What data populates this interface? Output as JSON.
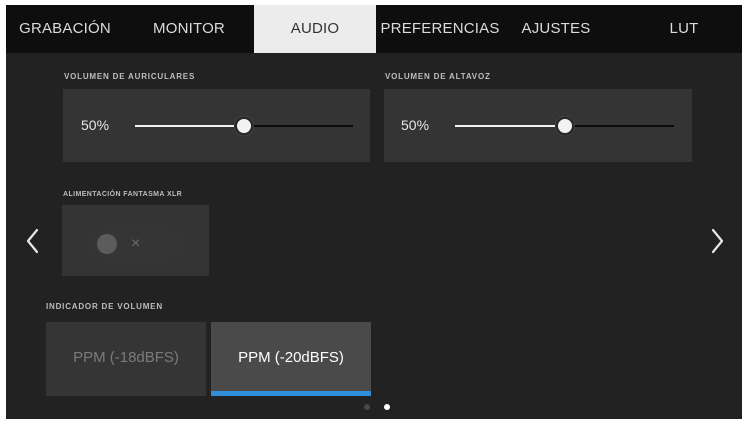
{
  "tabs": [
    {
      "label": "GRABACIÓN",
      "active": false
    },
    {
      "label": "MONITOR",
      "active": false
    },
    {
      "label": "AUDIO",
      "active": true
    },
    {
      "label": "PREFERENCIAS",
      "active": false
    },
    {
      "label": "AJUSTES",
      "active": false
    },
    {
      "label": "LUT",
      "active": false
    }
  ],
  "headphone_volume": {
    "label": "VOLUMEN DE AURICULARES",
    "value_text": "50%",
    "level": 0.5
  },
  "speaker_volume": {
    "label": "VOLUMEN DE ALTAVOZ",
    "value_text": "50%",
    "level": 0.5
  },
  "phantom_power": {
    "label": "ALIMENTACIÓN FANTASMA XLR",
    "state": "off",
    "off_symbol": "×"
  },
  "level_indicator": {
    "label": "INDICADOR DE VOLUMEN",
    "options": [
      {
        "label": "PPM (-18dBFS)",
        "selected": false
      },
      {
        "label": "PPM (-20dBFS)",
        "selected": true
      }
    ]
  },
  "pagination": {
    "pages": 2,
    "current": 2
  },
  "icons": {
    "prev": "chevron-left-icon",
    "next": "chevron-right-icon"
  },
  "colors": {
    "accent": "#2f8fdb",
    "active_tab_bg": "#ececec",
    "background": "#222222"
  }
}
